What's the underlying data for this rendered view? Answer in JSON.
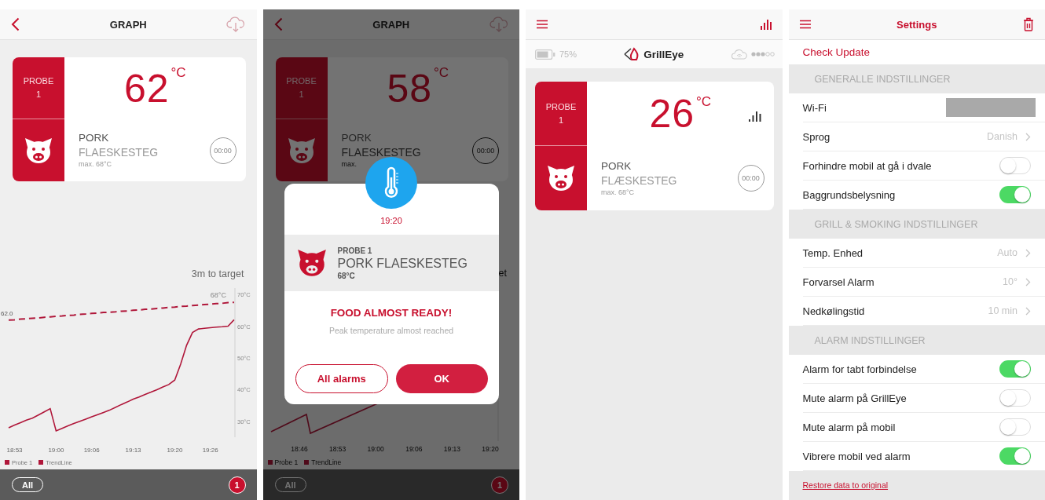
{
  "graph_screen": {
    "header": {
      "title": "GRAPH"
    },
    "probe_card": {
      "probe": "PROBE 1",
      "temperature": "62",
      "unit": "°C",
      "meat": "PORK",
      "cut": "FLAESKESTEG",
      "max": "max. 68°C",
      "timer": "00:00"
    },
    "target_note": "3m to target",
    "chart_data": {
      "type": "line",
      "categories": [
        null,
        "18:53",
        null,
        null,
        null,
        null,
        null,
        null,
        "19:00",
        null,
        null,
        null,
        null,
        null,
        "19:06",
        null,
        null,
        null,
        null,
        null,
        null,
        "19:13",
        null,
        null,
        null,
        null,
        null,
        null,
        "19:20",
        null,
        null,
        null,
        null,
        null,
        "19:26",
        null,
        null,
        null,
        null
      ],
      "legend": "bottom",
      "series": [
        {
          "name": "Probe 1",
          "color": "#b0173a",
          "line_style": "solid",
          "values": [
            28,
            28.8,
            29.6,
            30.4,
            31,
            32,
            33,
            34,
            27,
            27.8,
            28.6,
            29.3,
            30,
            30.7,
            31.4,
            32.1,
            32.8,
            33.5,
            34.4,
            35.3,
            36.1,
            37,
            37.7,
            38.5,
            39.2,
            40,
            40.8,
            41.6,
            43,
            48,
            54,
            58,
            59.1,
            59.3,
            59.5,
            59.7,
            59.8,
            60,
            62
          ]
        },
        {
          "name": "TrendLine",
          "color": "#b0173a",
          "line_style": "dashed",
          "values": [
            61.9,
            62,
            62.2,
            62.3,
            62.5,
            62.6,
            62.8,
            62.9,
            63.1,
            63.2,
            63.4,
            63.5,
            63.7,
            63.8,
            64,
            64.1,
            64.3,
            64.4,
            64.5,
            64.7,
            64.8,
            65,
            65.1,
            65.3,
            65.4,
            65.6,
            65.7,
            65.9,
            66,
            66.2,
            66.3,
            66.5,
            66.6,
            66.8,
            66.9,
            67.1,
            67.2,
            67.4,
            67.5
          ]
        }
      ],
      "ylim": [
        25,
        72
      ],
      "yticks": [
        {
          "value": 30,
          "label": "30°C"
        },
        {
          "value": 40,
          "label": "40°C"
        },
        {
          "value": 50,
          "label": "50°C"
        },
        {
          "value": 60,
          "label": "60°C"
        },
        {
          "value": 70,
          "label": "70°C"
        }
      ],
      "annotations": [
        "62.0",
        "68°C"
      ]
    },
    "bottom_bar": {
      "filter": "All",
      "badge": "1"
    }
  },
  "alarm_screen": {
    "header": {
      "title": "GRAPH"
    },
    "probe_card": {
      "probe": "PROBE 1",
      "temperature": "58",
      "unit": "°C",
      "meat": "PORK",
      "cut": "FLAESKESTEG",
      "max": "max.",
      "timer": "00:00"
    },
    "target_note": "et",
    "graph": {
      "x_labels": [
        "18:46",
        "18:53",
        "19:00",
        "19:06",
        "19:13",
        "19:20"
      ],
      "legend": [
        "Probe 1",
        "TrendLine"
      ]
    },
    "bottom_bar": {
      "filter": "All",
      "badge": "1"
    },
    "dialog": {
      "time": "19:20",
      "probe": "PROBE 1",
      "food": "PORK FLAESKESTEG",
      "temperature": "68°C",
      "title": "FOOD ALMOST READY!",
      "message": "Peak temperature almost reached",
      "buttons": [
        {
          "label": "All alarms",
          "kind": "secondary"
        },
        {
          "label": "OK",
          "kind": "primary"
        }
      ]
    }
  },
  "home_screen": {
    "battery": "75%",
    "logo": "GrillEye",
    "probe_card": {
      "probe": "PROBE 1",
      "temperature": "26",
      "unit": "°C",
      "meat": "PORK",
      "cut": "FLÆSKESTEG",
      "max": "max. 68°C",
      "timer": "00:00"
    }
  },
  "settings_screen": {
    "header": {
      "title": "Settings"
    },
    "check_update": "Check Update",
    "sections": [
      {
        "title": "GENERALLE INDSTILLINGER",
        "rows": [
          {
            "label": "Wi-Fi",
            "kind": "redacted"
          },
          {
            "label": "Sprog",
            "kind": "value",
            "value": "Danish"
          },
          {
            "label": "Forhindre mobil at gå i dvale",
            "kind": "toggle",
            "on": false
          },
          {
            "label": "Baggrundsbelysning",
            "kind": "toggle",
            "on": true
          }
        ]
      },
      {
        "title": "GRILL & SMOKING INDSTILLINGER",
        "rows": [
          {
            "label": "Temp. Enhed",
            "kind": "value",
            "value": "Auto"
          },
          {
            "label": "Forvarsel Alarm",
            "kind": "value",
            "value": "10°"
          },
          {
            "label": "Nedkølingstid",
            "kind": "value",
            "value": "10 min"
          }
        ]
      },
      {
        "title": "ALARM INDSTILLINGER",
        "rows": [
          {
            "label": "Alarm for tabt forbindelse",
            "kind": "toggle",
            "on": true
          },
          {
            "label": "Mute alarm på GrillEye",
            "kind": "toggle",
            "on": false
          },
          {
            "label": "Mute alarm på mobil",
            "kind": "toggle",
            "on": false
          },
          {
            "label": "Vibrere mobil ved alarm",
            "kind": "toggle",
            "on": true
          }
        ]
      }
    ],
    "restore_link": "Restore data to original"
  }
}
